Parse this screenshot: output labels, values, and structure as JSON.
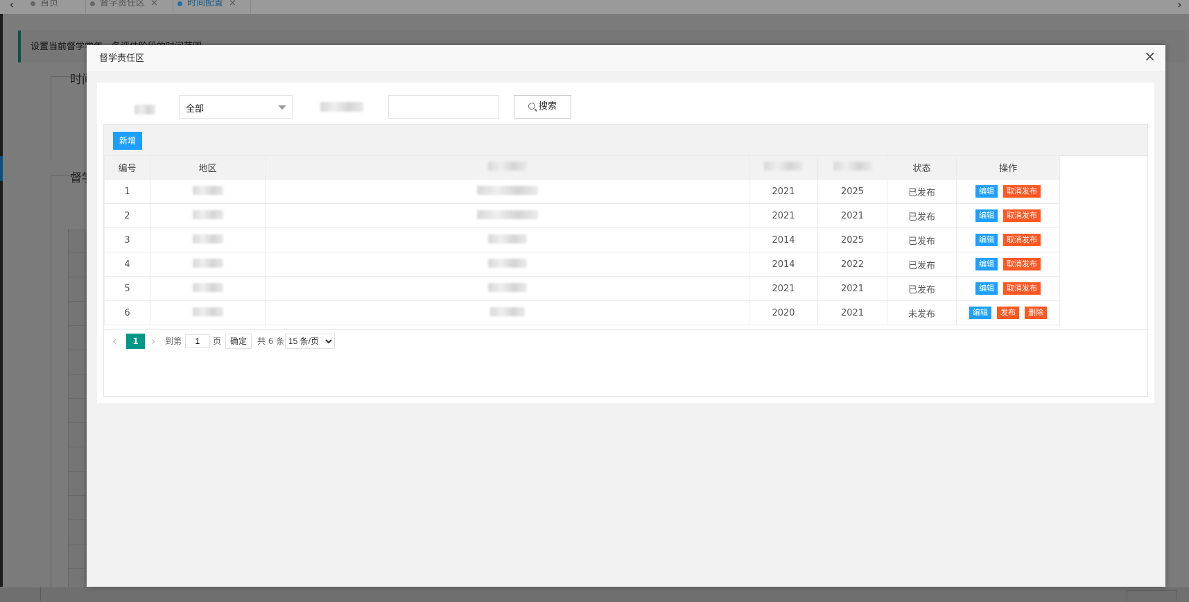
{
  "tabs": [
    {
      "label": "首页",
      "closable": false,
      "active": false
    },
    {
      "label": "督学责任区",
      "closable": true,
      "active": false
    },
    {
      "label": "时间配置",
      "closable": true,
      "active": true
    }
  ],
  "background": {
    "notice": "设置当前督学学年，各评估阶段的时间范围",
    "field1_label": "时间",
    "field2_label": "督学"
  },
  "modal": {
    "title": "督学责任区",
    "close_glyph": "×",
    "filter": {
      "select_value": "全部",
      "search_label": "搜索"
    },
    "add_label": "新增",
    "table": {
      "headers": [
        "编号",
        "地区",
        "",
        "",
        "",
        "状态",
        "操作"
      ],
      "rows": [
        {
          "id": "1",
          "start": "2021",
          "end": "2025",
          "status": "已发布",
          "actions": [
            "编辑",
            "取消发布"
          ]
        },
        {
          "id": "2",
          "start": "2021",
          "end": "2021",
          "status": "已发布",
          "actions": [
            "编辑",
            "取消发布"
          ]
        },
        {
          "id": "3",
          "start": "2014",
          "end": "2025",
          "status": "已发布",
          "actions": [
            "编辑",
            "取消发布"
          ]
        },
        {
          "id": "4",
          "start": "2014",
          "end": "2022",
          "status": "已发布",
          "actions": [
            "编辑",
            "取消发布"
          ]
        },
        {
          "id": "5",
          "start": "2021",
          "end": "2021",
          "status": "已发布",
          "actions": [
            "编辑",
            "取消发布"
          ]
        },
        {
          "id": "6",
          "start": "2020",
          "end": "2021",
          "status": "未发布",
          "actions": [
            "编辑",
            "发布",
            "删除"
          ]
        }
      ]
    },
    "pager": {
      "current": "1",
      "goto_label": "到第",
      "goto_value": "1",
      "page_unit": "页",
      "confirm": "确定",
      "total": "共 6 条",
      "page_size": "15 条/页"
    }
  }
}
